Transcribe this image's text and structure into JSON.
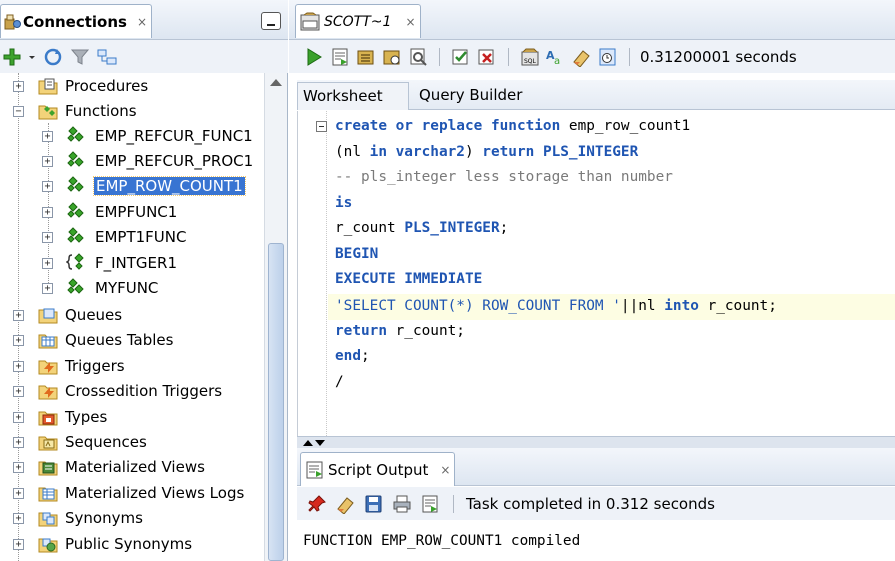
{
  "connections_panel": {
    "tab_title": "Connections",
    "tab_close": "×"
  },
  "tree": {
    "procedures": "Procedures",
    "functions": "Functions",
    "function_items": [
      "EMP_REFCUR_FUNC1",
      "EMP_REFCUR_PROC1",
      "EMP_ROW_COUNT1",
      "EMPFUNC1",
      "EMPT1FUNC",
      "F_INTGER1",
      "MYFUNC"
    ],
    "other_items": [
      "Queues",
      "Queues Tables",
      "Triggers",
      "Crossedition Triggers",
      "Types",
      "Sequences",
      "Materialized Views",
      "Materialized Views Logs",
      "Synonyms",
      "Public Synonyms"
    ],
    "selected": "EMP_ROW_COUNT1"
  },
  "editor_tab": {
    "title": "SCOTT~1",
    "close": "×"
  },
  "toolbar": {
    "timing": "0.31200001 seconds"
  },
  "subtabs": {
    "worksheet": "Worksheet",
    "query_builder": "Query Builder"
  },
  "code": {
    "l1_kw": "create or replace function",
    "l1_rest": " emp_row_count1",
    "l2_a": "(nl ",
    "l2_kw1": "in varchar2",
    "l2_b": ") ",
    "l2_kw2": "return PLS_INTEGER",
    "l3": "-- pls_integer less storage than number",
    "l4": "is",
    "l5_a": "r_count ",
    "l5_kw": "PLS_INTEGER",
    "l5_b": ";",
    "l6": "BEGIN",
    "l7": "EXECUTE IMMEDIATE",
    "l8_str": "'SELECT COUNT(*) ROW_COUNT FROM '",
    "l8_a": "||nl ",
    "l8_kw": "into",
    "l8_b": " r_count;",
    "l9_kw": "return",
    "l9_rest": " r_count;",
    "l10_kw": "end",
    "l10_rest": ";",
    "l11": "/"
  },
  "output_panel": {
    "tab_title": "Script Output",
    "close": "×",
    "status": "Task completed in 0.312 seconds",
    "text": "FUNCTION EMP_ROW_COUNT1 compiled"
  },
  "colors": {
    "keyword": "#1f55b2",
    "comment": "#7a7a7a",
    "selection": "#3874d2",
    "line_highlight": "#fdfde3"
  }
}
